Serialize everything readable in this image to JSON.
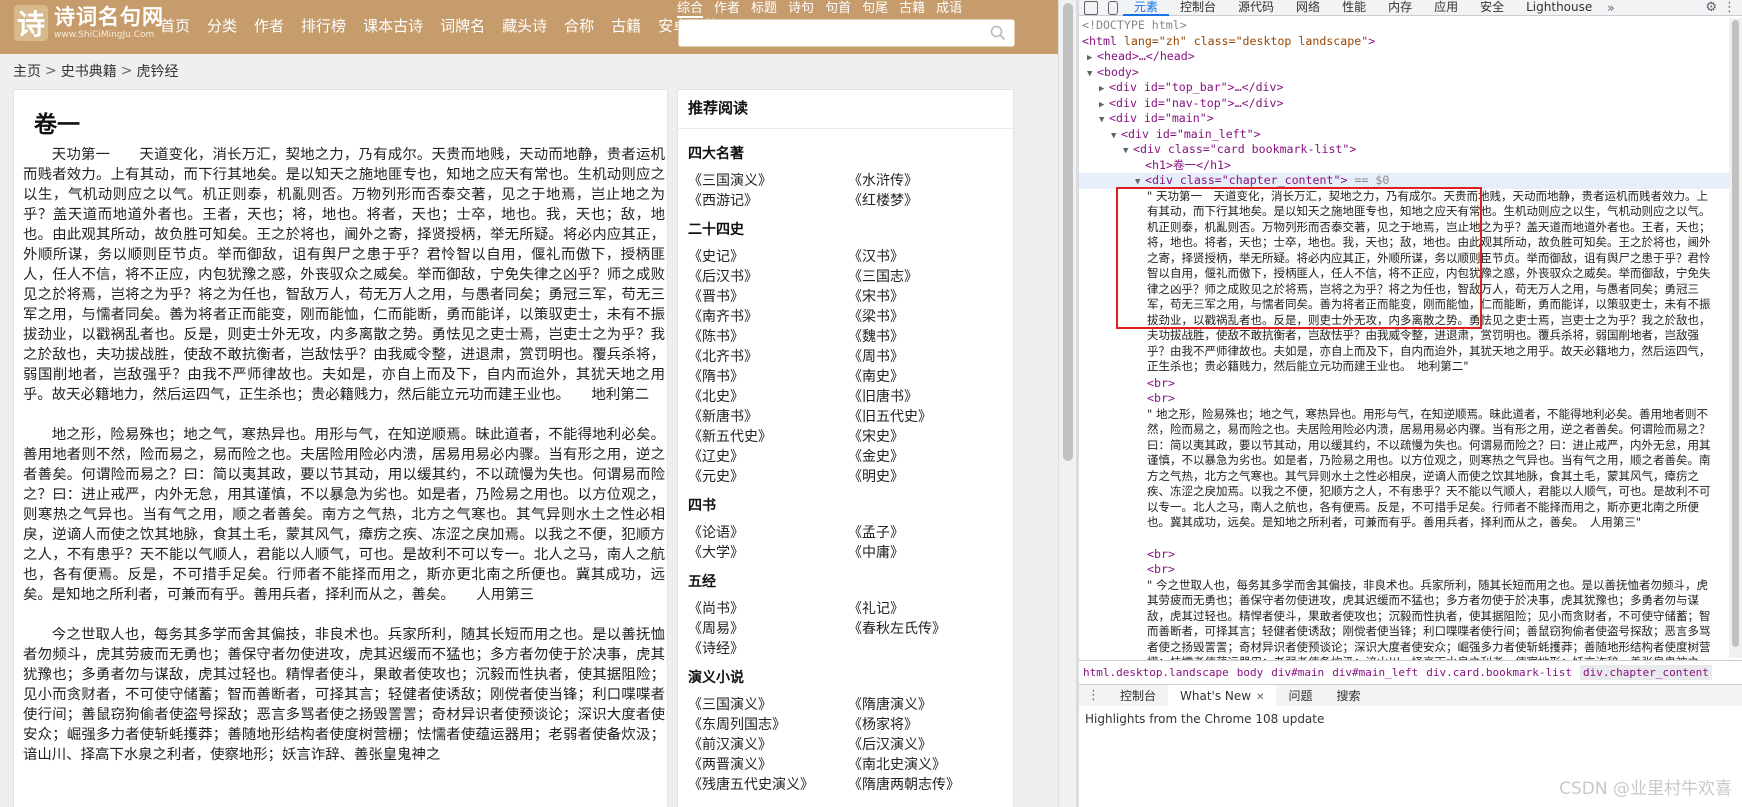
{
  "site": {
    "logo_mark": "诗",
    "logo_name": "诗词名句网",
    "logo_domain": "www.ShiCiMingJu.Com",
    "nav": [
      "首页",
      "分类",
      "作者",
      "排行榜",
      "课本古诗",
      "词牌名",
      "藏头诗",
      "合称",
      "古籍",
      "安卓下载"
    ],
    "search_tabs": [
      "综合",
      "作者",
      "标题",
      "诗句",
      "句首",
      "句尾",
      "古籍",
      "成语"
    ],
    "search_placeholder": "",
    "breadcrumb": [
      "主页",
      "史书典籍",
      "虎钤经"
    ],
    "chapter_title": "卷一",
    "paragraphs": [
      "天功第一　　天道变化，消长万汇，契地之力，乃有成尔。天贵而地贱，天动而地静，贵者运机而贱者效力。上有其动，而下行其地矣。是以知天之施地匪专也，知地之应天有常也。生机动则应之以生，气机动则应之以气。机正则泰，机亂则否。万物列形而否泰交著，见之于地焉，岂止地之为乎？盖天道而地道外者也。王者，天也；将，地也。将者，天也；士卒，地也。我，天也；敌，地也。由此观其所动，故负胜可知矣。王之於将也，阃外之寄，择贤授柄，举无所疑。将必内应其正，外顺所谋，务以顺则臣节贞。举而御敌，诅有舆尸之患于乎？君怜智以自用，偃礼而傲下，授柄匪人，任人不信，将不正应，内包犹豫之惑，外丧驭众之威矣。举而御敌，宁免失律之凶乎？师之成败见之於将焉，岂将之为乎？将之为任也，智敌万人，苟无万人之用，与愚者同矣；勇冠三军，苟无三军之用，与懦者同矣。善为将者正而能变，刚而能恤，仁而能断，勇而能详，以策驭吏士，未有不振拔劲业，以戳祸乱者也。反是，则吏士外无攻，内多离散之势。勇怯见之吏士焉，岂吏士之为乎？我之於敌也，夫功拔战胜，使敌不敢抗衡者，岂敌怯乎？由我威令整，进退肃，赏罚明也。覆兵杀将，弱国削地者，岂敌强乎？由我不严师律故也。夫如是，亦自上而及下，自内而迨外，其犹天地之用乎。故天必籍地力，然后运四气，正生杀也；贵必籍贱力，然后能立元功而建王业也。　　地利第二",
      "地之形，险易殊也；地之气，寒热异也。用形与气，在知逆顺焉。昧此道者，不能得地利必矣。善用地者则不然，险而易之，易而险之也。夫居险用险必内溃，居易用易必内骤。当有形之用，逆之者善矣。何谓险而易之？曰：简以夷其政，要以节其动，用以缓其约，不以疏慢为失也。何谓易而险之？曰：进止戒严，内外无怠，用其谨慎，不以暴急为劣也。如是者，乃险易之用也。以方位观之，则寒热之气异也。当有气之用，顺之者善矣。南方之气热，北方之气寒也。其气异则水土之性必相戾，逆谪人而使之饮其地脉，食其土毛，蒙其风气，瘴疠之疾、冻涩之戾加焉。以我之不便，犯顺方之人，不有患乎？天不能以气顺人，君能以人顺气，可也。是故利不可以专一。北人之马，南人之航也，各有便焉。反是，不可措手足矣。行师者不能择而用之，斯亦更北南之所便也。冀其成功，远矣。是知地之所利者，可兼而有乎。善用兵者，择利而从之，善矣。　　人用第三",
      "今之世取人也，每务其多学而舍其偏技，非良术也。兵家所利，随其长短而用之也。是以善抚恤者勿频斗，虎其劳疲而无勇也；善保守者勿使进攻，虎其迟缓而不猛也；多方者勿使于於决事，虎其犹豫也；多勇者勿与谋敌，虎其过轻也。精悍者使斗，果敢者使攻也；沉毅而性执者，使其据阻险；见小而贪财者，不可使守储蓄；智而善断者，可择其言；轻健者使诱敌；刚傥者使当锋；利口喋喋者使行间；善鼠窃狗偷者使盗号探敌；恶言多骂者使之扬毁詈詈；奇材异识者使预谈论；深识大度者使安众；崛强多力者使斩蚝擭莽；善随地形结构者使度树营栅；怯懦者使蕴运器用；老弱者使备炊汲；谙山川、择高下水泉之利者，使察地形；妖言诈辞、善张皇鬼神之"
    ],
    "sidebar_heading": "推荐阅读",
    "sidebar_groups": [
      {
        "title": "四大名著",
        "items": [
          "《三国演义》",
          "《水浒传》",
          "《西游记》",
          "《红楼梦》"
        ]
      },
      {
        "title": "二十四史",
        "items": [
          "《史记》",
          "《汉书》",
          "《后汉书》",
          "《三国志》",
          "《晋书》",
          "《宋书》",
          "《南齐书》",
          "《梁书》",
          "《陈书》",
          "《魏书》",
          "《北齐书》",
          "《周书》",
          "《隋书》",
          "《南史》",
          "《北史》",
          "《旧唐书》",
          "《新唐书》",
          "《旧五代史》",
          "《新五代史》",
          "《宋史》",
          "《辽史》",
          "《金史》",
          "《元史》",
          "《明史》"
        ]
      },
      {
        "title": "四书",
        "items": [
          "《论语》",
          "《孟子》",
          "《大学》",
          "《中庸》"
        ]
      },
      {
        "title": "五经",
        "items": [
          "《尚书》",
          "《礼记》",
          "《周易》",
          "《春秋左氏传》",
          "《诗经》"
        ]
      },
      {
        "title": "演义小说",
        "items": [
          "《三国演义》",
          "《隋唐演义》",
          "《东周列国志》",
          "《杨家将》",
          "《前汉演义》",
          "《后汉演义》",
          "《两晋演义》",
          "《南北史演义》",
          "《残唐五代史演义》",
          "《隋唐两朝志传》"
        ]
      }
    ]
  },
  "devtools": {
    "tabs": [
      "元素",
      "控制台",
      "源代码",
      "网络",
      "性能",
      "内存",
      "应用",
      "安全",
      "Lighthouse"
    ],
    "active_tab": "元素",
    "dom": {
      "doctype": "<!DOCTYPE html>",
      "html_open": "html",
      "html_attrs": "lang=\"zh\" class=\"desktop landscape\"",
      "head": "<head>…</head>",
      "body": "<body>",
      "top_bar": "<div id=\"top_bar\">…</div>",
      "nav_top": "<div id=\"nav-top\">…</div>",
      "main": "<div id=\"main\">",
      "main_left": "<div id=\"main_left\">",
      "card": "<div class=\"card bookmark-list\">",
      "h1": "<h1>卷一</h1>",
      "chapter": "<div class=\"chapter_content\">",
      "chapter_suffix": "== $0",
      "text1": "\" 天功第一　天道变化，消长万汇，契地之力，乃有成尔。天贵而地贱，天动而地静，贵者运机而贱者效力。上有其动，而下行其地矣。是以知天之施地匪专也，知地之应天有常也。生机动则应之以生，气机动则应之以气。机正则泰，机亂则否。万物列形而否泰交著，见之于地焉，岂止地之为乎？盖天道而地道外者也。王者，天也；将，地也。将者，天也；士卒，地也。我，天也；敌，地也。由此观其所动，故负胜可知矣。王之於将也，阃外之寄，择贤授柄，举无所疑。将必内应其正，外顺所谋，务以顺则臣节贞。举而御敌，诅有舆尸之患于乎？君怜智以自用，偃礼而傲下，授柄匪人，任人不信，将不正应，内包犹豫之惑，外丧驭众之威矣。举而御敌，宁免失律之凶乎？师之成败见之於将焉，岂将之为乎？将之为任也，智敌万人，苟无万人之用，与愚者同矣；勇冠三军，苟无三军之用，与懦者同矣。善为将者正而能变，刚而能恤，仁而能断，勇而能详，以策驭吏士，未有不振拔劲业，以戳祸乱者也。反是，则吏士外无攻，内多离散之势。勇怯见之吏士焉，岂吏士之为乎？我之於敌也，夫功拔战胜，使敌不敢抗衡者，岂敌怯乎？由我威令整，进退肃，赏罚明也。覆兵杀将，弱国削地者，岂敌强乎？由我不严师律故也。夫如是，亦自上而及下，自内而迨外，其犹天地之用乎。故天必籍地力，然后运四气，正生杀也；贵必籍贱力，然后能立元功而建王业也。　地利第二\"",
      "br": "<br>",
      "text2": "\" 地之形，险易殊也；地之气，寒热异也。用形与气，在知逆顺焉。昧此道者，不能得地利必矣。善用地者则不然，险而易之，易而险之也。夫居险用险必内溃，居易用易必内骤。当有形之用，逆之者善矣。何谓险而易之？曰：简以夷其政，要以节其动，用以缓其约，不以疏慢为失也。何谓易而险之？曰：进止戒严，内外无怠，用其谨慎，不以暴急为劣也。如是者，乃险易之用也。以方位观之，则寒热之气异也。当有气之用，顺之者善矣。南方之气热，北方之气寒也。其气异则水土之性必相戾，逆谪人而使之饮其地脉，食其土毛，蒙其风气，瘴疠之疾、冻涩之戾加焉。以我之不便，犯顺方之人，不有患乎？天不能以气顺人，君能以人顺气，可也。是故利不可以专一。北人之马，南人之航也，各有便焉。反是，不可措手足矣。行师者不能择而用之，斯亦更北南之所便也。冀其成功，远矣。是知地之所利者，可兼而有乎。善用兵者，择利而从之，善矣。　人用第三\"",
      "text3": "\" 今之世取人也，每务其多学而舍其偏技，非良术也。兵家所利，随其长短而用之也。是以善抚恤者勿频斗，虎其劳疲而无勇也；善保守者勿使进攻，虎其迟缓而不猛也；多方者勿使于於决事，虎其犹豫也；多勇者勿与谋敌，虎其过轻也。精悍者使斗，果敢者使攻也；沉毅而性执者，使其据阻险；见小而贪财者，不可使守储蓄；智而善断者，可择其言；轻健者使诱敌；刚傥者使当锋；利口喋喋者使行间；善鼠窃狗偷者使盗号探敌；恶言多骂者使之扬毁詈詈；奇材异识者使预谈论；深识大度者使安众；崛强多力者使斩蚝擭莽；善随地形结构者使度树营栅；怯懦者使蕴运器用；老弱者使备炊汲；谙山川、择高下水泉之利者，使察地形；妖言诈辞、善张皇鬼神之"
    },
    "breadcrumb": [
      "html.desktop.landscape",
      "body",
      "div#main",
      "div#main_left",
      "div.card.bookmark-list",
      "div.chapter_content"
    ],
    "drawer_tabs": [
      "控制台",
      "What's New",
      "问题",
      "搜索"
    ],
    "drawer_active": "What's New",
    "drawer_text": "Highlights from the Chrome 108 update"
  },
  "watermark": "CSDN @业里村牛欢喜",
  "colors": {
    "topbar": "#c69c6c",
    "highlight_box": "#e02020",
    "devtools_accent": "#1a73e8"
  }
}
